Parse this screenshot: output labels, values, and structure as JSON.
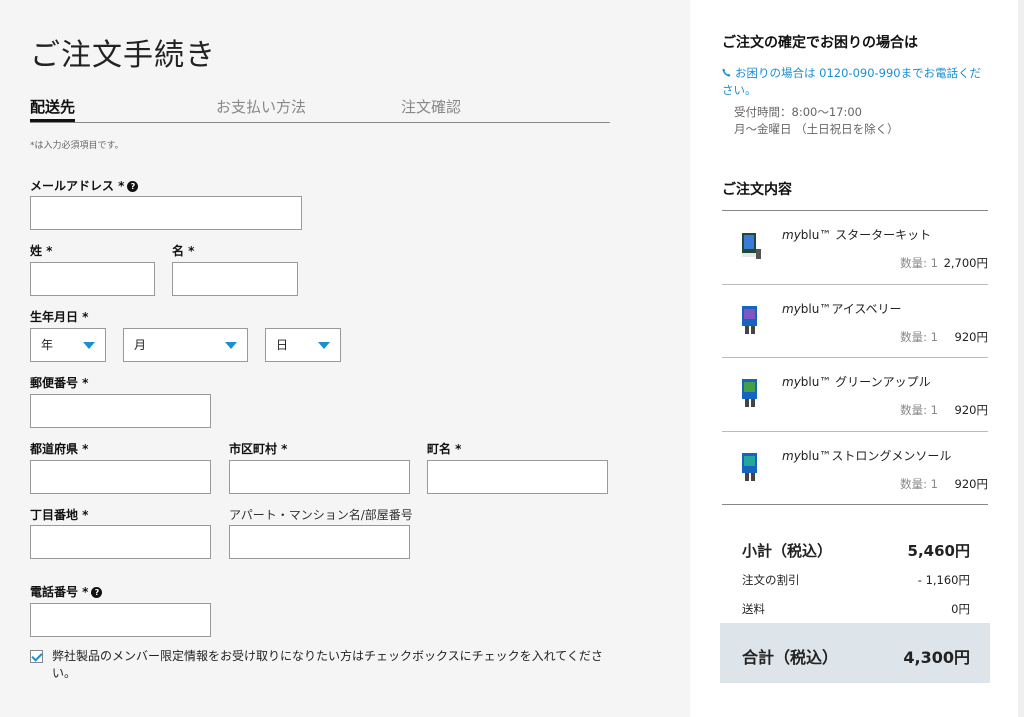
{
  "page": {
    "title": "ご注文手続き",
    "required_note": "*は入力必須項目です。"
  },
  "tabs": [
    {
      "label": "配送先",
      "active": true
    },
    {
      "label": "お支払い方法",
      "active": false
    },
    {
      "label": "注文確認",
      "active": false
    }
  ],
  "form": {
    "email_label": "メールアドレス *",
    "last_name_label": "姓 *",
    "first_name_label": "名 *",
    "birthdate_label": "生年月日 *",
    "year_value": "年",
    "month_value": "月",
    "day_value": "日",
    "postal_label": "郵便番号 *",
    "prefecture_label": "都道府県 *",
    "city_label": "市区町村 *",
    "town_label": "町名 *",
    "block_label": "丁目番地 *",
    "building_label": "アパート・マンション名/部屋番号",
    "phone_label": "電話番号 *",
    "newsletter_text": "弊社製品のメンバー限定情報をお受け取りになりたい方はチェックボックスにチェックを入れてください。",
    "newsletter_checked": true
  },
  "help": {
    "heading": "ご注文の確定でお困りの場合は",
    "link_text": "お困りの場合は 0120-090-990までお電話ください。",
    "hours": "受付時間：8:00〜17:00",
    "days": "月〜金曜日 （土日祝日を除く）"
  },
  "order": {
    "heading": "ご注文内容",
    "qty_prefix": "数量: ",
    "items": [
      {
        "brand": "my",
        "name": "blu™ スターターキット",
        "qty": "1",
        "price": "2,700円"
      },
      {
        "brand": "my",
        "name": "blu™アイスベリー",
        "qty": "1",
        "price": "920円"
      },
      {
        "brand": "my",
        "name": "blu™ グリーンアップル",
        "qty": "1",
        "price": "920円"
      },
      {
        "brand": "my",
        "name": "blu™ストロングメンソール",
        "qty": "1",
        "price": "920円"
      }
    ],
    "subtotal_label": "小計（税込）",
    "subtotal_value": "5,460円",
    "discount_label": "注文の割引",
    "discount_value": "- 1,160円",
    "shipping_label": "送料",
    "shipping_value": "0円",
    "total_label": "合計（税込）",
    "total_value": "4,300円"
  },
  "colors": {
    "accent": "#1a8fd1",
    "left_bg": "#f5f5f5",
    "total_bg": "#dde4ea"
  }
}
